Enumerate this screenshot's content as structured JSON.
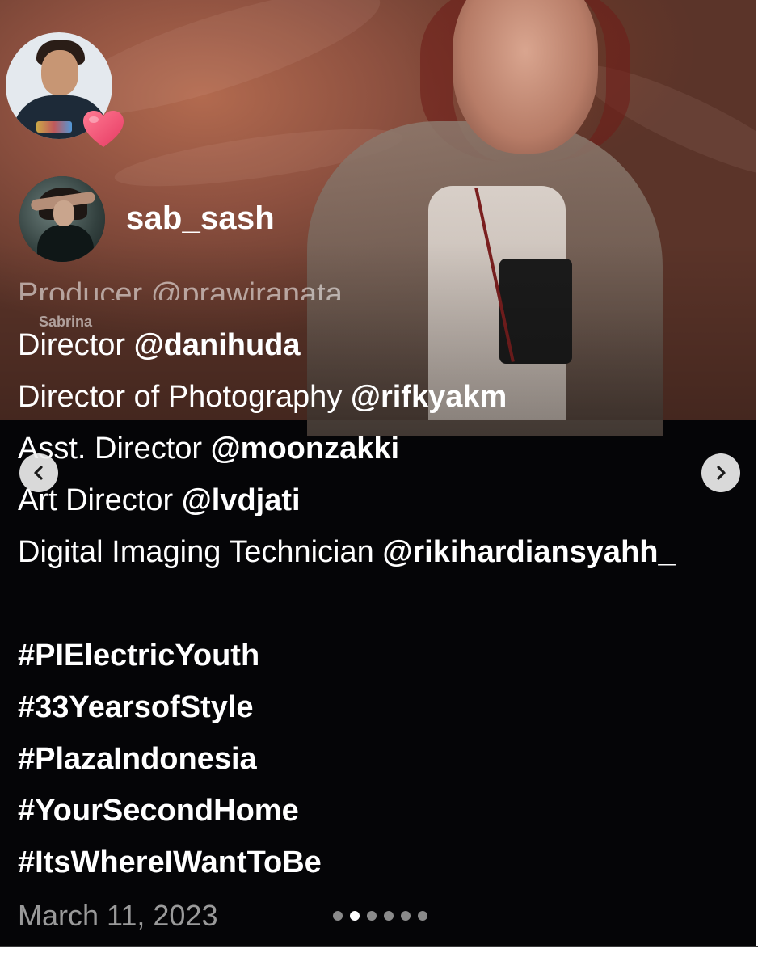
{
  "reaction": {
    "avatar_icon": "user-avatar-icon",
    "badge_icon": "heart-icon",
    "badge_color": "#f0507a"
  },
  "post": {
    "username": "sab_sash",
    "partial_previous_line": "Producer @prawiranata",
    "overlay_name": "Sabrina",
    "caption_lines": [
      {
        "role": "Director ",
        "handle": "@danihuda"
      },
      {
        "role": "Director of Photography ",
        "handle": "@rifkyakm"
      },
      {
        "role": "Asst. Director ",
        "handle": "@moonzakki"
      },
      {
        "role": "Art Director ",
        "handle": "@lvdjati"
      },
      {
        "role": "Digital Imaging Technician ",
        "handle": "@rikihardiansyahh_"
      }
    ],
    "hashtags": [
      "#PIElectricYouth",
      "#33YearsofStyle",
      "#PlazaIndonesia",
      "#YourSecondHome",
      "#ItsWhereIWantToBe"
    ],
    "date": "March 11, 2023"
  },
  "navigation": {
    "prev_icon": "chevron-left-icon",
    "next_icon": "chevron-right-icon"
  },
  "carousel": {
    "total": 6,
    "active_index": 1
  },
  "colors": {
    "background": "#050507",
    "text": "#ffffff",
    "muted": "#9a9a9a"
  }
}
